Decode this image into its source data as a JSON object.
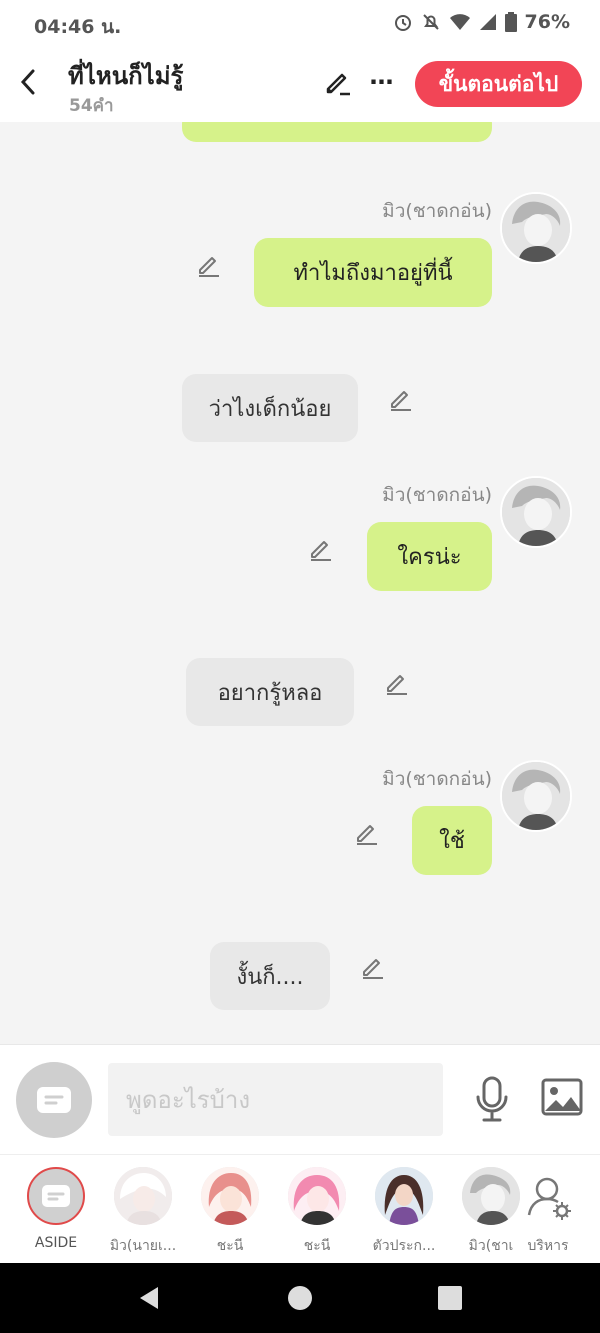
{
  "status": {
    "time": "04:46 น.",
    "battery": "76%"
  },
  "header": {
    "title": "ที่ไหนก็ไม่รู้",
    "word_count": "54คำ",
    "next_label": "ขั้นตอนต่อไป",
    "more_glyph": "⋯"
  },
  "messages": [
    {
      "side": "right",
      "sender": "มิว(ชาดกอ่น)",
      "text": "ทำไมถึงมาอยู่ที่นี้"
    },
    {
      "side": "left",
      "text": "ว่าไงเด็กน้อย"
    },
    {
      "side": "right",
      "sender": "มิว(ชาดกอ่น)",
      "text": "ใครน่ะ"
    },
    {
      "side": "left",
      "text": "อยากรู้หลอ"
    },
    {
      "side": "right",
      "sender": "มิว(ชาดกอ่น)",
      "text": "ใช้"
    },
    {
      "side": "left",
      "text": "งั้นก็...."
    }
  ],
  "input": {
    "placeholder": "พูดอะไรบ้าง"
  },
  "characters": [
    {
      "name": "ASIDE",
      "icon": "aside-icon",
      "selected": true
    },
    {
      "name": "มิว(นายเ...",
      "icon": "avatar"
    },
    {
      "name": "ชะนี",
      "icon": "avatar"
    },
    {
      "name": "ชะนี",
      "icon": "avatar"
    },
    {
      "name": "ตัวประก...",
      "icon": "avatar"
    },
    {
      "name": "มิว(ชาเ",
      "icon": "avatar"
    },
    {
      "name": "บริหาร",
      "icon": "manage-icon"
    }
  ],
  "colors": {
    "accent": "#f24556",
    "bubble_right": "#d6f28a",
    "bubble_left": "#e8e8e8"
  }
}
